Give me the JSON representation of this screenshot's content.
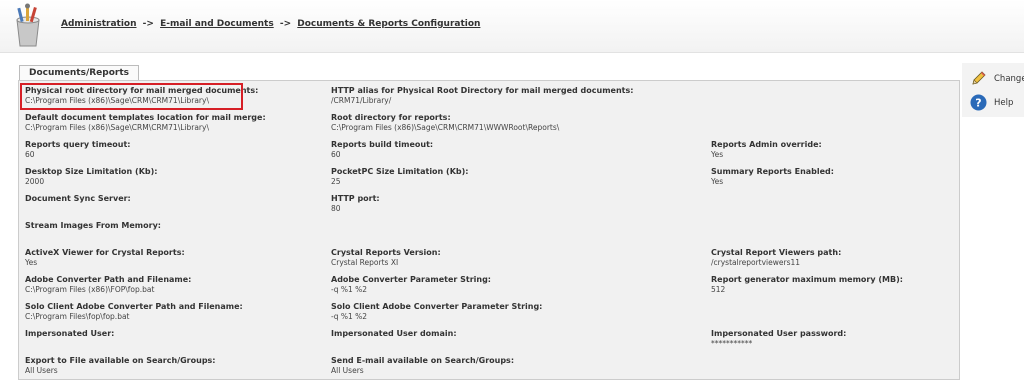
{
  "header": {
    "breadcrumb": {
      "items": [
        "Administration",
        "E-mail and Documents",
        "Documents & Reports Configuration"
      ],
      "separator": "->"
    }
  },
  "tab": {
    "label": "Documents/Reports"
  },
  "fields": {
    "physical_root": {
      "label": "Physical root directory for mail merged documents:",
      "value": "C:\\Program Files (x86)\\Sage\\CRM\\CRM71\\Library\\"
    },
    "http_alias": {
      "label": "HTTP alias for Physical Root Directory for mail merged documents:",
      "value": "/CRM71/Library/"
    },
    "default_templates": {
      "label": "Default document templates location for mail merge:",
      "value": "C:\\Program Files (x86)\\Sage\\CRM\\CRM71\\Library\\"
    },
    "root_reports": {
      "label": "Root directory for reports:",
      "value": "C:\\Program Files (x86)\\Sage\\CRM\\CRM71\\WWWRoot\\Reports\\"
    },
    "query_timeout": {
      "label": "Reports query timeout:",
      "value": "60"
    },
    "build_timeout": {
      "label": "Reports build timeout:",
      "value": "60"
    },
    "admin_override": {
      "label": "Reports Admin override:",
      "value": "Yes"
    },
    "desktop_size": {
      "label": "Desktop Size Limitation (Kb):",
      "value": "2000"
    },
    "pocketpc_size": {
      "label": "PocketPC Size Limitation (Kb):",
      "value": "25"
    },
    "summary_enabled": {
      "label": "Summary Reports Enabled:",
      "value": "Yes"
    },
    "doc_sync": {
      "label": "Document Sync Server:",
      "value": ""
    },
    "http_port": {
      "label": "HTTP port:",
      "value": "80"
    },
    "stream_images": {
      "label": "Stream Images From Memory:",
      "value": ""
    },
    "activex": {
      "label": "ActiveX Viewer for Crystal Reports:",
      "value": "Yes"
    },
    "crystal_version": {
      "label": "Crystal Reports Version:",
      "value": "Crystal Reports XI"
    },
    "crystal_viewers": {
      "label": "Crystal Report Viewers path:",
      "value": "/crystalreportviewers11"
    },
    "adobe_path": {
      "label": "Adobe Converter Path and Filename:",
      "value": "C:\\Program Files (x86)\\FOP\\fop.bat"
    },
    "adobe_params": {
      "label": "Adobe Converter Parameter String:",
      "value": "-q %1 %2"
    },
    "max_memory": {
      "label": "Report generator maximum memory (MB):",
      "value": "512"
    },
    "solo_path": {
      "label": "Solo Client Adobe Converter Path and Filename:",
      "value": "C:\\Program Files\\fop\\fop.bat"
    },
    "solo_params": {
      "label": "Solo Client Adobe Converter Parameter String:",
      "value": "-q %1 %2"
    },
    "imp_user": {
      "label": "Impersonated User:",
      "value": ""
    },
    "imp_domain": {
      "label": "Impersonated User domain:",
      "value": ""
    },
    "imp_password": {
      "label": "Impersonated User password:",
      "value": "***********"
    },
    "export_file": {
      "label": "Export to File available on Search/Groups:",
      "value": "All Users"
    },
    "send_email": {
      "label": "Send E-mail available on Search/Groups:",
      "value": "All Users"
    }
  },
  "actions": {
    "change": {
      "label": "Change",
      "icon": "pencil-icon"
    },
    "help": {
      "label": "Help",
      "icon": "help-icon"
    }
  },
  "colors": {
    "highlight": "#d61f26",
    "help_blue": "#2a6ab8",
    "panel": "#f1f1f1"
  }
}
